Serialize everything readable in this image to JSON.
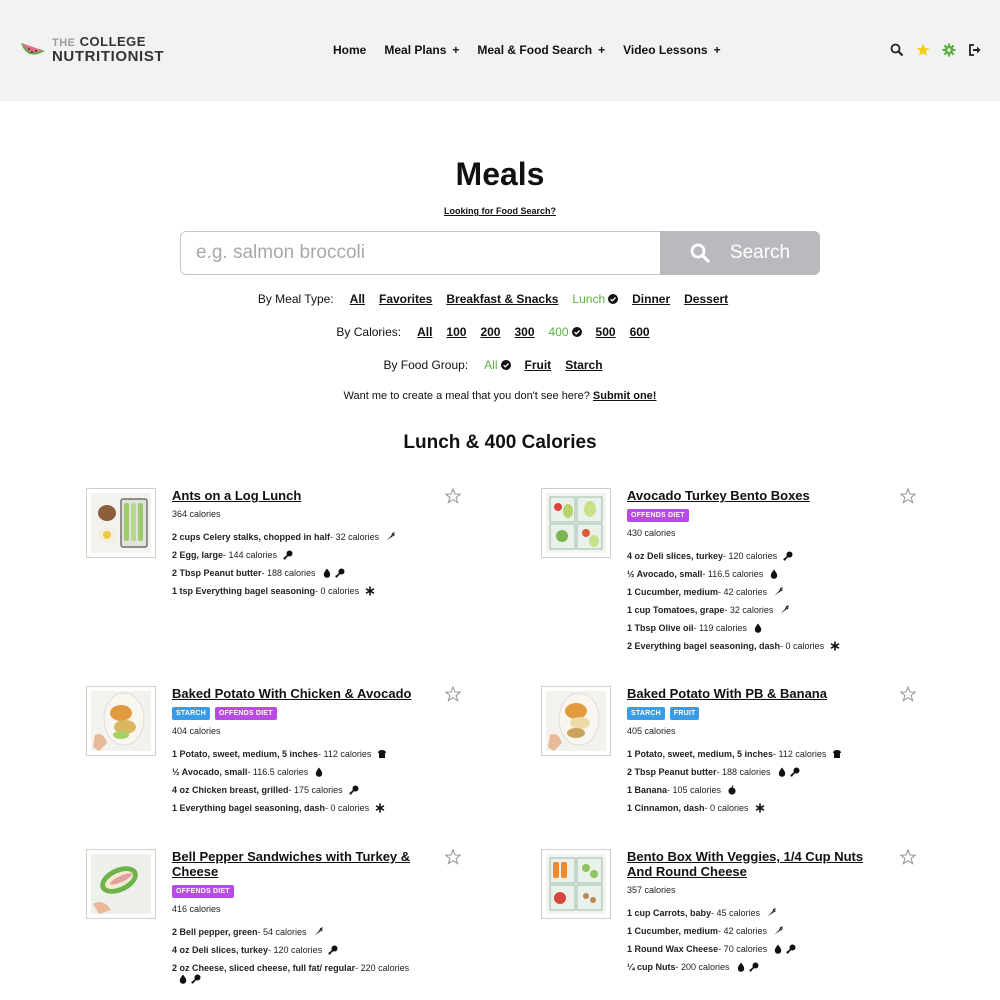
{
  "header": {
    "logo_line1_prefix": "THE",
    "logo_line1": "COLLEGE",
    "logo_line2": "NUTRITIONIST",
    "nav": [
      {
        "label": "Home",
        "plus": ""
      },
      {
        "label": "Meal Plans",
        "plus": "+"
      },
      {
        "label": "Meal & Food Search",
        "plus": "+"
      },
      {
        "label": "Video Lessons",
        "plus": "+"
      }
    ],
    "icons": [
      "search-icon",
      "star-icon",
      "gear-icon",
      "logout-icon"
    ],
    "colors": {
      "star": "#f2cf1f",
      "gear": "#5bb043"
    }
  },
  "main": {
    "title": "Meals",
    "food_search_link": "Looking for Food Search?",
    "search": {
      "placeholder": "e.g. salmon broccoli",
      "button_label": "Search"
    },
    "filters": {
      "meal_type": {
        "label": "By Meal Type:",
        "options": [
          "All",
          "Favorites",
          "Breakfast & Snacks",
          "Lunch",
          "Dinner",
          "Dessert"
        ],
        "active": "Lunch"
      },
      "calories": {
        "label": "By Calories:",
        "options": [
          "All",
          "100",
          "200",
          "300",
          "400",
          "500",
          "600"
        ],
        "active": "400"
      },
      "food_group": {
        "label": "By Food Group:",
        "options": [
          "All",
          "Fruit",
          "Starch"
        ],
        "active": "All"
      }
    },
    "request_text": "Want me to create a meal that you don't see here?",
    "request_link": "Submit one!",
    "section_title": "Lunch & 400 Calories",
    "accent_color": "#5bb043"
  },
  "meals": [
    {
      "title": "Ants on a Log Lunch",
      "badges": [],
      "calories": "364 calories",
      "ingredients": [
        {
          "name": "2 cups Celery stalks, chopped in half",
          "cal": " - 32 calories",
          "icons": [
            "carrot-icon"
          ]
        },
        {
          "name": "2 Egg, large",
          "cal": " - 144 calories",
          "icons": [
            "drumstick-icon"
          ]
        },
        {
          "name": "2 Tbsp Peanut butter",
          "cal": " - 188 calories",
          "icons": [
            "drop-icon",
            "drumstick-icon"
          ]
        },
        {
          "name": "1 tsp Everything bagel seasoning",
          "cal": " - 0 calories",
          "icons": [
            "asterisk-icon"
          ]
        }
      ]
    },
    {
      "title": "Avocado Turkey Bento Boxes",
      "badges": [
        {
          "label": "OFFENDS DIET",
          "kind": "offends"
        }
      ],
      "calories": "430 calories",
      "ingredients": [
        {
          "name": "4 oz Deli slices, turkey",
          "cal": " - 120 calories",
          "icons": [
            "drumstick-icon"
          ]
        },
        {
          "name": "½ Avocado, small",
          "cal": " - 116.5 calories",
          "icons": [
            "drop-icon"
          ]
        },
        {
          "name": "1 Cucumber, medium",
          "cal": " - 42 calories",
          "icons": [
            "carrot-icon"
          ]
        },
        {
          "name": "1 cup Tomatoes, grape",
          "cal": " - 32 calories",
          "icons": [
            "carrot-icon"
          ]
        },
        {
          "name": "1 Tbsp Olive oil",
          "cal": " - 119 calories",
          "icons": [
            "drop-icon"
          ]
        },
        {
          "name": "2 Everything bagel seasoning, dash",
          "cal": " - 0 calories",
          "icons": [
            "asterisk-icon"
          ]
        }
      ]
    },
    {
      "title": "Baked Potato With Chicken & Avocado",
      "badges": [
        {
          "label": "STARCH",
          "kind": "starch"
        },
        {
          "label": "OFFENDS DIET",
          "kind": "offends"
        }
      ],
      "calories": "404 calories",
      "ingredients": [
        {
          "name": "1 Potato, sweet, medium, 5 inches",
          "cal": " - 112 calories",
          "icons": [
            "bread-icon"
          ]
        },
        {
          "name": "½ Avocado, small",
          "cal": " - 116.5 calories",
          "icons": [
            "drop-icon"
          ]
        },
        {
          "name": "4 oz Chicken breast, grilled",
          "cal": " - 175 calories",
          "icons": [
            "drumstick-icon"
          ]
        },
        {
          "name": "1 Everything bagel seasoning, dash",
          "cal": " - 0 calories",
          "icons": [
            "asterisk-icon"
          ]
        }
      ]
    },
    {
      "title": "Baked Potato With PB & Banana",
      "badges": [
        {
          "label": "STARCH",
          "kind": "starch"
        },
        {
          "label": "FRUIT",
          "kind": "fruit"
        }
      ],
      "calories": "405 calories",
      "ingredients": [
        {
          "name": "1 Potato, sweet, medium, 5 inches",
          "cal": " - 112 calories",
          "icons": [
            "bread-icon"
          ]
        },
        {
          "name": "2 Tbsp Peanut butter",
          "cal": " - 188 calories",
          "icons": [
            "drop-icon",
            "drumstick-icon"
          ]
        },
        {
          "name": "1 Banana",
          "cal": " - 105 calories",
          "icons": [
            "apple-icon"
          ]
        },
        {
          "name": "1 Cinnamon, dash",
          "cal": " - 0 calories",
          "icons": [
            "asterisk-icon"
          ]
        }
      ]
    },
    {
      "title": "Bell Pepper Sandwiches with Turkey & Cheese",
      "badges": [
        {
          "label": "OFFENDS DIET",
          "kind": "offends"
        }
      ],
      "calories": "416 calories",
      "ingredients": [
        {
          "name": "2 Bell pepper, green",
          "cal": " - 54 calories",
          "icons": [
            "carrot-icon"
          ]
        },
        {
          "name": "4 oz Deli slices, turkey",
          "cal": " - 120 calories",
          "icons": [
            "drumstick-icon"
          ]
        },
        {
          "name": "2 oz Cheese, sliced cheese, full fat/ regular",
          "cal": " - 220 calories",
          "icons": [
            "drop-icon",
            "drumstick-icon"
          ]
        }
      ]
    },
    {
      "title": "Bento Box With Veggies, 1/4 Cup Nuts And Round Cheese",
      "badges": [],
      "calories": "357 calories",
      "ingredients": [
        {
          "name": "1 cup Carrots, baby",
          "cal": " - 45 calories",
          "icons": [
            "carrot-icon"
          ]
        },
        {
          "name": "1 Cucumber, medium",
          "cal": " - 42 calories",
          "icons": [
            "carrot-icon"
          ]
        },
        {
          "name": "1 Round Wax Cheese",
          "cal": " - 70 calories",
          "icons": [
            "drop-icon",
            "drumstick-icon"
          ]
        },
        {
          "name": "¼ cup Nuts",
          "cal": " - 200 calories",
          "icons": [
            "drop-icon",
            "drumstick-icon"
          ]
        }
      ]
    }
  ]
}
